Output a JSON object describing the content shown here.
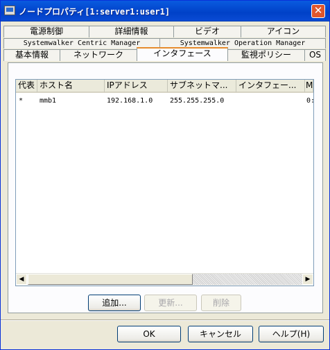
{
  "window": {
    "title": "ノードプロパティ[1:server1:user1]"
  },
  "tabs": {
    "row1": [
      "電源制御",
      "詳細情報",
      "ビデオ",
      "アイコン"
    ],
    "row2": [
      "Systemwalker Centric Manager",
      "Systemwalker Operation Manager"
    ],
    "row3": [
      "基本情報",
      "ネットワーク",
      "インタフェース",
      "監視ポリシー",
      "OS"
    ],
    "active": "インタフェース"
  },
  "list": {
    "columns": [
      "代表",
      "ホスト名",
      "IPアドレス",
      "サブネットマ...",
      "インタフェー...",
      "MA"
    ],
    "rows": [
      [
        "*",
        "mmb1",
        "192.168.1.0",
        "255.255.255.0",
        "",
        "0:"
      ]
    ]
  },
  "panel_buttons": {
    "add": "追加...",
    "update": "更新...",
    "delete": "削除"
  },
  "dialog_buttons": {
    "ok": "OK",
    "cancel": "キャンセル",
    "help": "ヘルプ(H)"
  },
  "icons": {
    "app": "node-window-icon",
    "close": "close-icon",
    "scroll_left": "arrow-left-icon",
    "scroll_right": "arrow-right-icon"
  }
}
